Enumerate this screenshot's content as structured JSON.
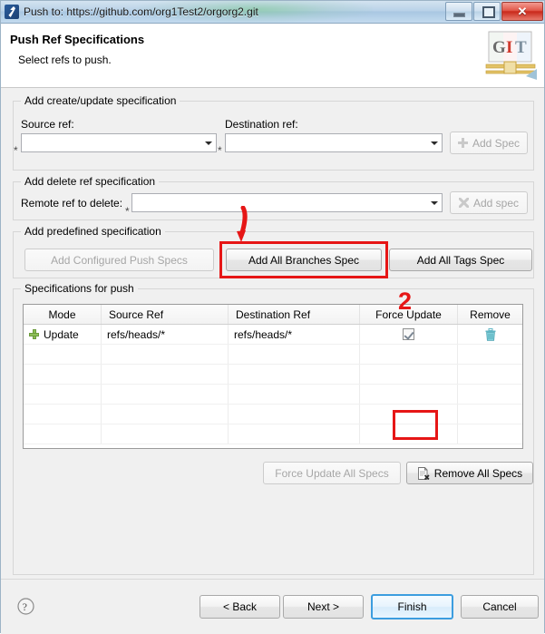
{
  "window": {
    "title": "Push to: https://github.com/org1Test2/orgorg2.git",
    "app_icon": "eclipse-git-icon",
    "controls": {
      "minimize": "minimize-icon",
      "maximize": "maximize-icon",
      "close": "✕"
    }
  },
  "header": {
    "title": "Push Ref Specifications",
    "subtitle": "Select refs to push.",
    "logo_text_g": "G",
    "logo_text_i": "I",
    "logo_text_t": "T"
  },
  "create_update_group": {
    "title": "Add create/update specification",
    "source_label": "Source ref:",
    "source_value": "",
    "source_star": "*",
    "destination_label": "Destination ref:",
    "destination_value": "",
    "destination_star": "*",
    "add_spec_button": "Add Spec",
    "add_spec_enabled": false
  },
  "delete_group": {
    "title": "Add delete ref specification",
    "remote_label": "Remote ref to delete:",
    "remote_value": "",
    "remote_star": "*",
    "add_spec_button": "Add spec",
    "add_spec_enabled": false
  },
  "predefined_group": {
    "title": "Add predefined specification",
    "add_configured_push_specs": "Add Configured Push Specs",
    "add_all_branches_spec": "Add All Branches Spec",
    "add_all_tags_spec": "Add All Tags Spec"
  },
  "specs_group": {
    "title": "Specifications for push",
    "columns": [
      "Mode",
      "Source Ref",
      "Destination Ref",
      "Force Update",
      "Remove"
    ],
    "rows": [
      {
        "mode": "Update",
        "source_ref": "refs/heads/*",
        "destination_ref": "refs/heads/*",
        "force_update": true,
        "remove_icon": "trash-icon",
        "mode_icon": "green-plus-icon"
      }
    ],
    "empty_row_count": 5,
    "force_update_all_specs": "Force Update All Specs",
    "force_update_all_enabled": false,
    "remove_all_specs": "Remove All Specs",
    "remove_all_enabled": true
  },
  "footer": {
    "help_icon": "question-mark-icon",
    "back": "< Back",
    "next": "Next >",
    "finish": "Finish",
    "cancel": "Cancel"
  },
  "annotations": {
    "step1_label": "",
    "step2_label": "2",
    "highlight_color": "#e61616"
  }
}
